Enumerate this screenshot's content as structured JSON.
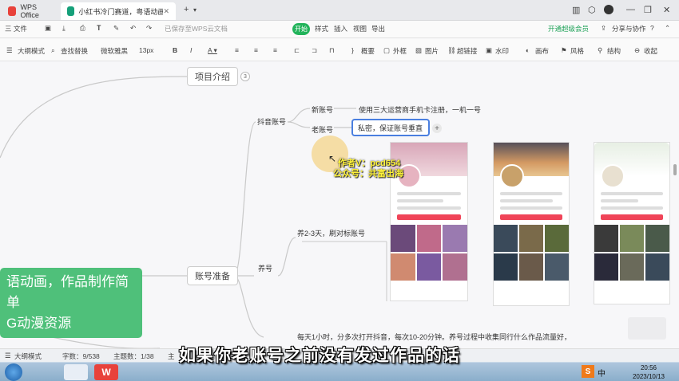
{
  "titlebar": {
    "home_tab": "WPS Office",
    "doc_tab": "小红书冷门赛道，粤语动画，作品",
    "new_tab": "+"
  },
  "menubar": {
    "file": "三 文件",
    "saved_status": "已保存至WPS云文档",
    "start": "开始",
    "style": "样式",
    "insert": "插入",
    "view": "视图",
    "export": "导出",
    "upgrade": "开通超级会员",
    "share": "分享与协作"
  },
  "toolbar": {
    "outline_mode": "大纲模式",
    "find_replace": "查找替换",
    "font": "微软雅黑",
    "font_size": "13px",
    "bold": "B",
    "summary": "概要",
    "frame": "外框",
    "image": "图片",
    "hyperlink": "超链接",
    "watermark": "水印",
    "canvas": "画布",
    "style": "风格",
    "structure": "结构",
    "collapse": "收起"
  },
  "mindmap": {
    "project_intro": "项目介绍",
    "project_intro_count": "3",
    "account_prep": "账号准备",
    "douyin_account": "抖音账号",
    "new_account": "新账号",
    "new_account_desc": "使用三大运营商手机卡注册，一机一号",
    "old_account": "老账号",
    "old_account_desc": "私密，保证账号垂直",
    "nurture": "养号",
    "nurture_desc": "养2-3天，刷对标账号",
    "daily_desc": "每天1小时，分多次打开抖音，每次10-20分钟。养号过程中收集同行什么作品流量好，",
    "green_line1": "语动画，作品制作简单",
    "green_line2": "G动漫资源"
  },
  "watermark": {
    "line1": "作者V：pcd654",
    "line2": "公众号：共富出海"
  },
  "statusbar": {
    "outline_mode": "大纲模式",
    "word_count": "字数：9/538",
    "topic_count": "主题数：1/38",
    "topic_prefix": "主"
  },
  "taskbar": {
    "time": "20:56",
    "date": "2023/10/13",
    "ime": "中"
  },
  "subtitle": "如果你老账号之前没有发过作品的话"
}
